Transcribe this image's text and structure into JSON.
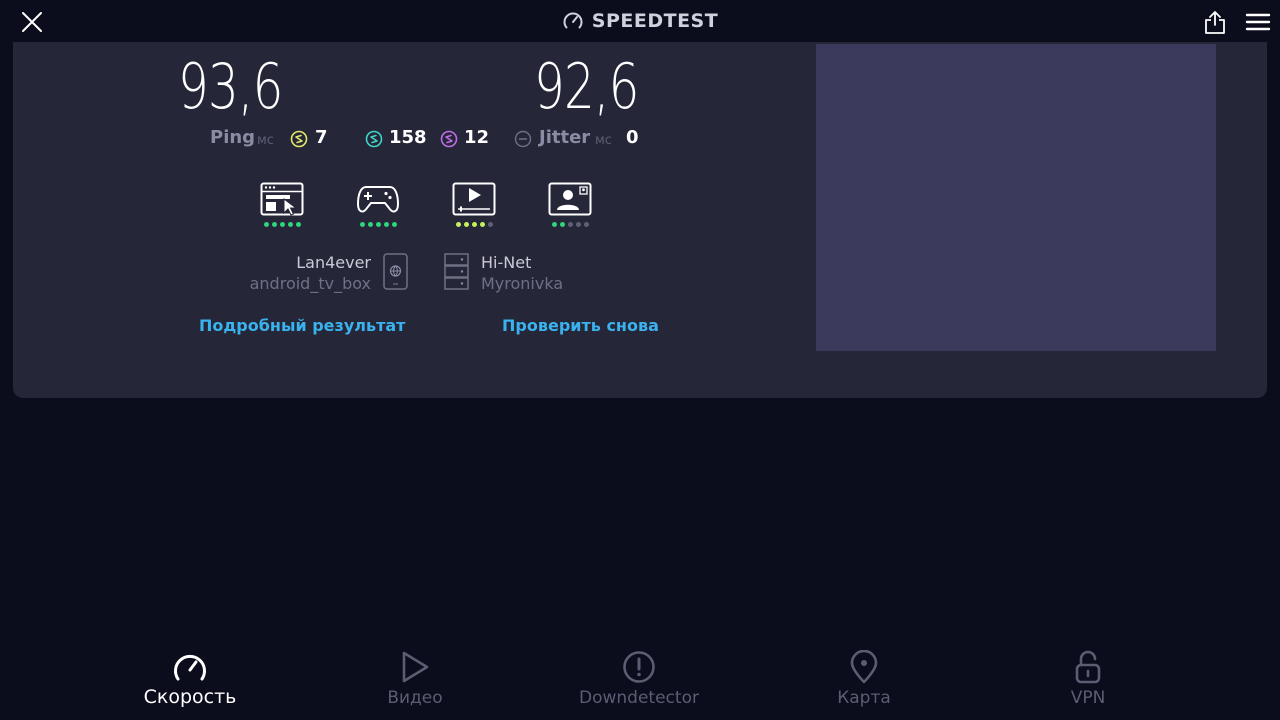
{
  "header": {
    "brand": "SPEEDTEST"
  },
  "results": {
    "download": "93,6",
    "upload": "92,6",
    "ping_label": "Ping",
    "ping_unit": "мс",
    "ping_idle": "7",
    "ping_download": "158",
    "ping_upload": "12",
    "jitter_label": "Jitter",
    "jitter_unit": "мс",
    "jitter": "0"
  },
  "usage": [
    {
      "name": "web-browsing",
      "score": 5
    },
    {
      "name": "gaming",
      "score": 5
    },
    {
      "name": "video-streaming",
      "score": 4
    },
    {
      "name": "video-chat",
      "score": 2
    }
  ],
  "provider": {
    "isp": "Lan4ever",
    "device": "android_tv_box"
  },
  "server": {
    "name": "Hi-Net",
    "location": "Myronivka"
  },
  "actions": {
    "detailed": "Подробный результат",
    "again": "Проверить снова"
  },
  "nav": {
    "items": [
      {
        "label": "Скорость",
        "icon": "speedometer-icon",
        "active": true
      },
      {
        "label": "Видео",
        "icon": "play-icon",
        "active": false
      },
      {
        "label": "Downdetector",
        "icon": "alert-icon",
        "active": false
      },
      {
        "label": "Карта",
        "icon": "map-pin-icon",
        "active": false
      },
      {
        "label": "VPN",
        "icon": "unlock-icon",
        "active": false
      }
    ]
  },
  "colors": {
    "background": "#0b0c1c",
    "card": "#252638",
    "link": "#3ab2ee",
    "ping_idle": "#e6e86a",
    "ping_download": "#3fd6c8",
    "ping_upload": "#c06de8",
    "good": "#2fd47c"
  }
}
